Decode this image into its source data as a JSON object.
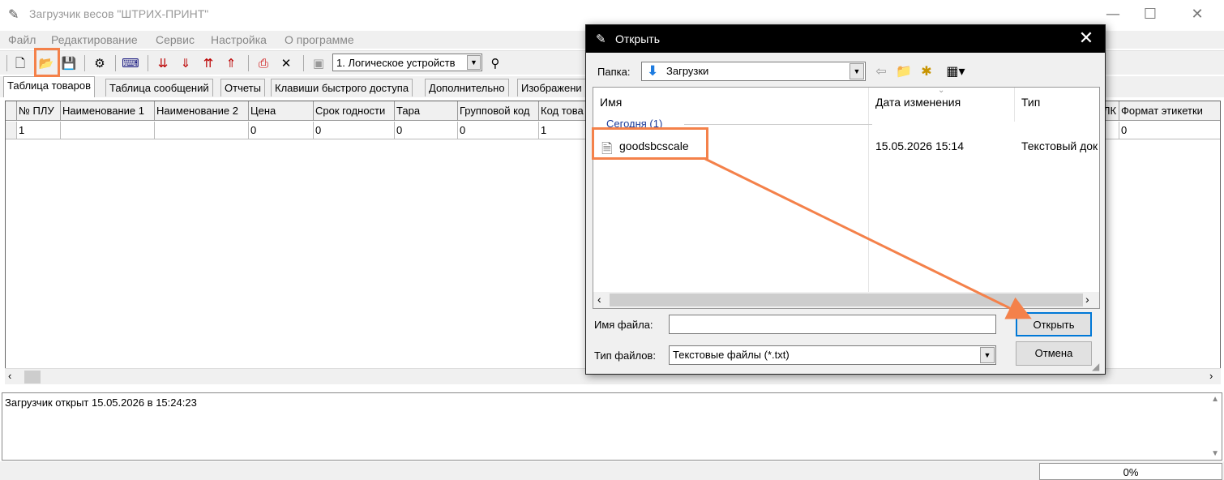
{
  "app": {
    "title": "Загрузчик весов \"ШТРИХ-ПРИНТ\"",
    "window_controls": {
      "minimize": "—",
      "maximize": "☐",
      "close": "✕"
    }
  },
  "menu": [
    "Файл",
    "Редактирование",
    "Сервис",
    "Настройка",
    "О программе"
  ],
  "toolbar": {
    "device_select": "1. Логическое устройств",
    "icons": [
      "new-file-icon",
      "open-folder-icon",
      "save-icon",
      "properties-icon",
      "keyboard-icon",
      "import-down-icon",
      "load-down-icon",
      "import-up-icon",
      "load-up-icon",
      "print-icon",
      "delete-icon",
      "device-icon",
      "connect-icon"
    ]
  },
  "tabs": [
    "Таблица товаров",
    "Таблица сообщений",
    "Отчеты",
    "Клавиши быстрого доступа",
    "Дополнительно",
    "Изображени"
  ],
  "grid": {
    "columns": [
      "№ ПЛУ",
      "Наименование 1",
      "Наименование 2",
      "Цена",
      "Срок годности",
      "Тара",
      "Групповой код",
      "Код това"
    ],
    "right_columns": [
      "ЛК",
      "Формат этикетки"
    ],
    "row": [
      "1",
      "",
      "",
      "0",
      "0",
      "0",
      "0",
      "1"
    ],
    "right_row": [
      "",
      "0"
    ]
  },
  "log": {
    "text": "Загрузчик открыт 15.05.2026 в 15:24:23"
  },
  "status": {
    "progress": "0%"
  },
  "dialog": {
    "title": "Открыть",
    "close": "✕",
    "folder_label": "Папка:",
    "folder_value": "Загрузки",
    "columns": {
      "name": "Имя",
      "date": "Дата изменения",
      "type": "Тип"
    },
    "group": "Сегодня (1)",
    "file": {
      "name": "goodsbcscale",
      "date": "15.05.2026 15:14",
      "type": "Текстовый док"
    },
    "filename_label": "Имя файла:",
    "filename_value": "",
    "filetype_label": "Тип файлов:",
    "filetype_value": "Текстовые файлы (*.txt)",
    "open_button": "Открыть",
    "cancel_button": "Отмена"
  },
  "colors": {
    "highlight": "#f4814a",
    "accent": "#0078d7",
    "group_text": "#1a3a9a"
  }
}
